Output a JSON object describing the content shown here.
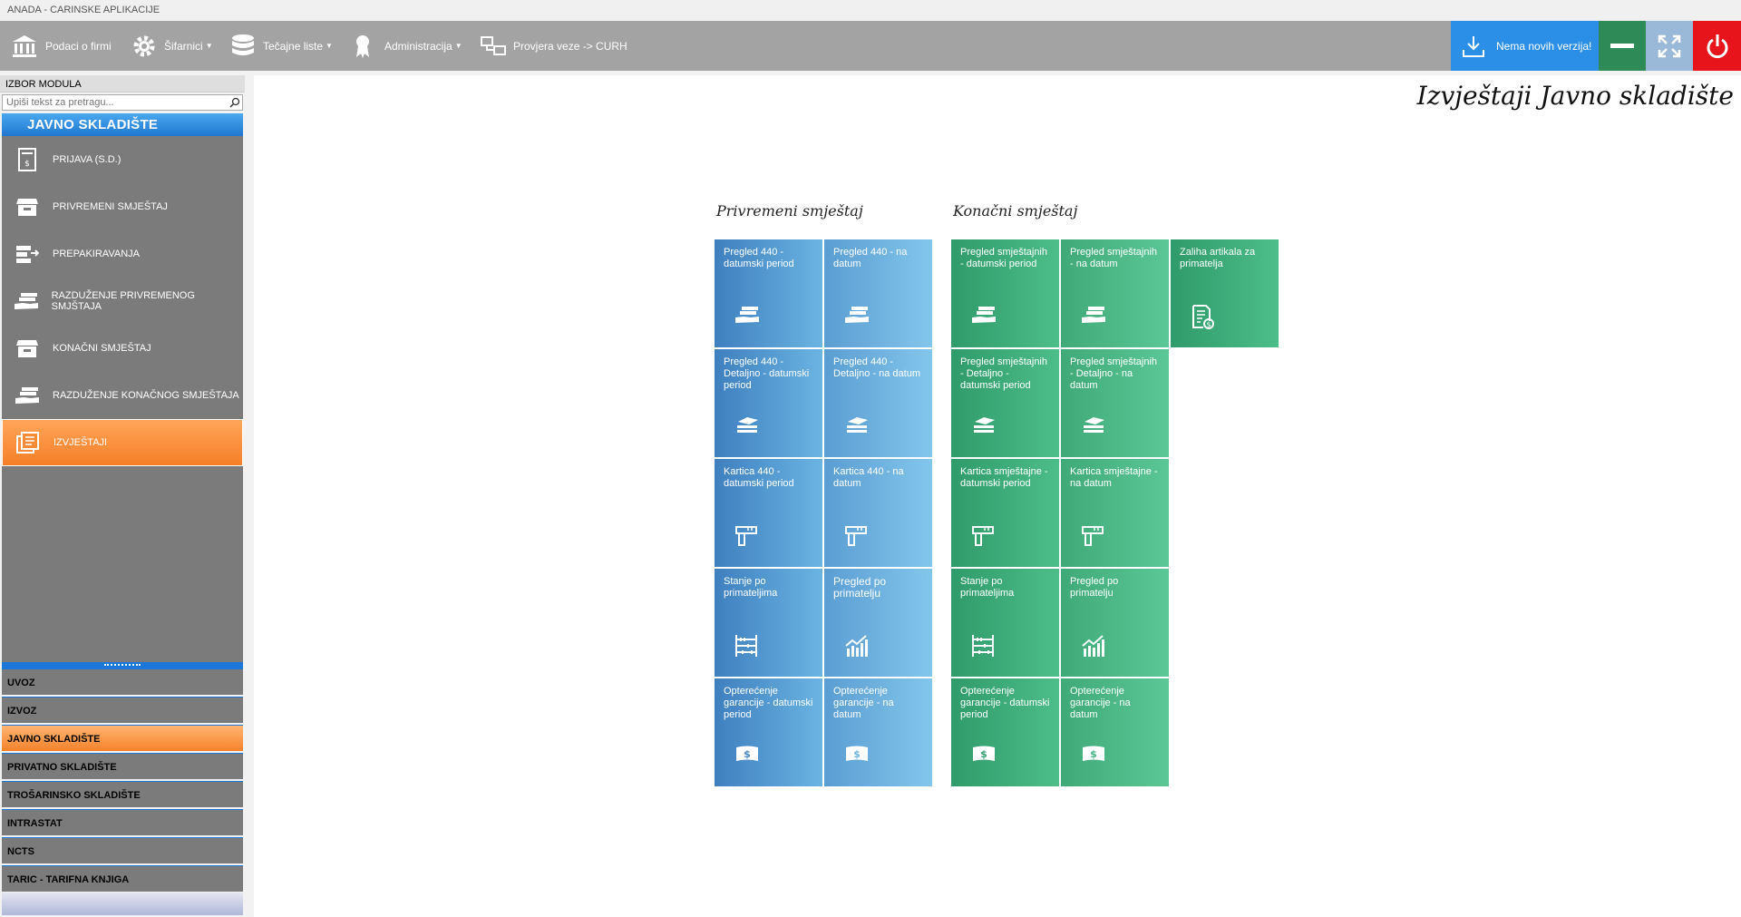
{
  "window": {
    "title": "ANADA - CARINSKE APLIKACIJE"
  },
  "toolbar": {
    "company_label": "Podaci o firmi",
    "codebooks_label": "Šifarnici",
    "rates_label": "Tečajne liste",
    "admin_label": "Administracija",
    "connection_label": "Provjera veze -> CURH",
    "updates_label": "Nema novih verzija!"
  },
  "sidebar": {
    "header": "IZBOR MODULA",
    "search_placeholder": "Upiši tekst za pretragu...",
    "group_title": "JAVNO SKLADIŠTE",
    "items": [
      {
        "label": "PRIJAVA (S.D.)"
      },
      {
        "label": "PRIVREMENI SMJEŠTAJ"
      },
      {
        "label": "PREPAKIRAVANJA"
      },
      {
        "label": "RAZDUŽENJE PRIVREMENOG SMJŠTAJA"
      },
      {
        "label": "KONAČNI SMJEŠTAJ"
      },
      {
        "label": "RAZDUŽENJE KONAČNOG SMJEŠTAJA"
      },
      {
        "label": "IZVJEŠTAJI"
      }
    ],
    "modules": [
      {
        "label": "UVOZ"
      },
      {
        "label": "IZVOZ"
      },
      {
        "label": "JAVNO SKLADIŠTE"
      },
      {
        "label": "PRIVATNO SKLADIŠTE"
      },
      {
        "label": "TROŠARINSKO SKLADIŠTE"
      },
      {
        "label": "INTRASTAT"
      },
      {
        "label": "NCTS"
      },
      {
        "label": "TARIC - TARIFNA KNJIGA"
      }
    ]
  },
  "main": {
    "title": "Izvještaji Javno skladište",
    "section_temp": "Privremeni smještaj",
    "section_final": "Konačni smještaj",
    "tiles_temp": [
      {
        "label": "Pregled 440 - datumski period"
      },
      {
        "label": "Pregled 440 - na datum"
      },
      {
        "label": "Pregled 440 - Detaljno - datumski period"
      },
      {
        "label": "Pregled 440 - Detaljno - na datum"
      },
      {
        "label": "Kartica 440 - datumski period"
      },
      {
        "label": "Kartica 440 - na datum"
      },
      {
        "label": "Stanje po primateljima"
      },
      {
        "label": "Pregled po primatelju"
      },
      {
        "label": "Opterećenje garancije - datumski period"
      },
      {
        "label": "Opterećenje garancije - na datum"
      }
    ],
    "tiles_final": [
      {
        "label": "Pregled smještajnih - datumski period"
      },
      {
        "label": "Pregled smještajnih - na datum"
      },
      {
        "label": "Zaliha artikala za primatelja"
      },
      {
        "label": "Pregled smještajnih - Detaljno - datumski period"
      },
      {
        "label": "Pregled smještajnih - Detaljno - na datum"
      },
      {
        "label": "Kartica smještajne - datumski period"
      },
      {
        "label": "Kartica smještajne - na datum"
      },
      {
        "label": "Stanje po primateljima"
      },
      {
        "label": "Pregled po primatelju"
      },
      {
        "label": "Opterećenje garancije - datumski period"
      },
      {
        "label": "Opterećenje garancije - na datum"
      }
    ]
  },
  "colors": {
    "toolbar": "#a3a3a3",
    "updates": "#2b8fe8",
    "minimize": "#2e8b57",
    "maximize": "#9ab8d8",
    "power": "#e8141b",
    "sidebar_active": "#f57f27",
    "tile_blue": "#4a8ac6",
    "tile_green": "#3aa874"
  },
  "icons": {
    "company": "bank-icon",
    "codebooks": "gear-icon",
    "rates": "database-icon",
    "admin": "award-icon",
    "connection": "network-icon",
    "updates": "download-icon",
    "minimize": "minus-icon",
    "maximize": "expand-icon",
    "power": "power-icon"
  }
}
